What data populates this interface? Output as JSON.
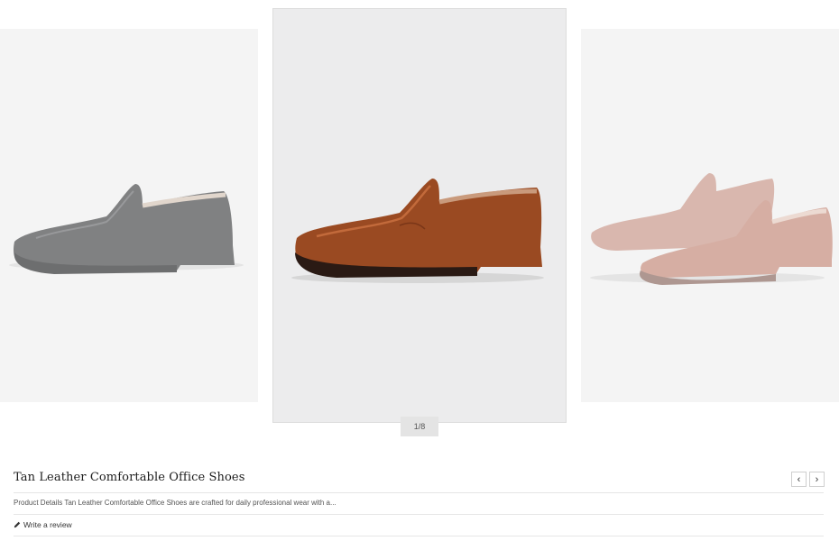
{
  "carousel": {
    "counter": "1/8",
    "slides": [
      {
        "id": "left",
        "shoe": "black-patent-loafer",
        "color": "#4a4b4d"
      },
      {
        "id": "center",
        "shoe": "tan-leather-loafer",
        "color": "#9a4a22"
      },
      {
        "id": "right",
        "shoe": "pink-leather-loafer-pair",
        "color": "#c48c7c"
      }
    ],
    "prev_icon": "chevron-left-icon",
    "next_icon": "chevron-right-icon"
  },
  "product": {
    "title": "Tan Leather Comfortable Office Shoes",
    "description": "Product Details Tan Leather Comfortable Office Shoes are crafted for daily professional wear with a...",
    "review_label": "Write a review",
    "review_icon": "pencil-icon"
  }
}
